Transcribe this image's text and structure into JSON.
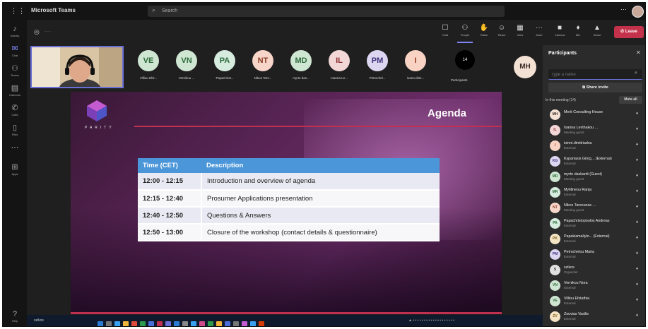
{
  "app": {
    "title": "Microsoft Teams"
  },
  "search": {
    "placeholder": "Search"
  },
  "rail": [
    {
      "label": "Activity",
      "icon": "bell-icon"
    },
    {
      "label": "Chat",
      "icon": "chat-icon"
    },
    {
      "label": "Teams",
      "icon": "teams-icon"
    },
    {
      "label": "Calendar",
      "icon": "calendar-icon"
    },
    {
      "label": "Calls",
      "icon": "phone-icon"
    },
    {
      "label": "Files",
      "icon": "file-icon"
    },
    {
      "label": "",
      "icon": "more-icon"
    },
    {
      "label": "Apps",
      "icon": "apps-icon"
    },
    {
      "label": "Help",
      "icon": "help-icon"
    }
  ],
  "meeting_controls": [
    {
      "label": "Chat",
      "glyph": "☐"
    },
    {
      "label": "People",
      "glyph": "⚇"
    },
    {
      "label": "Raise",
      "glyph": "✋"
    },
    {
      "label": "React",
      "glyph": "☺"
    },
    {
      "label": "View",
      "glyph": "▦"
    },
    {
      "label": "More",
      "glyph": "⋯"
    }
  ],
  "media_controls": [
    {
      "label": "Camera",
      "glyph": "■"
    },
    {
      "label": "Mic",
      "glyph": "♦"
    },
    {
      "label": "Share",
      "glyph": "▲"
    }
  ],
  "leave": {
    "label": "Leave"
  },
  "gallery": [
    {
      "initials": "VE",
      "name": "Villiou Elsl...",
      "bg": "#cfe6d2",
      "fg": "#2c6b3a"
    },
    {
      "initials": "VN",
      "name": "Vernikou ...",
      "bg": "#cfe6d2",
      "fg": "#2c6b3a"
    },
    {
      "initials": "PA",
      "name": "Papachrist...",
      "bg": "#d5ecdf",
      "fg": "#2c6b3a"
    },
    {
      "initials": "NT",
      "name": "Nikos Tars...",
      "bg": "#f7d5c8",
      "fg": "#8a3b23"
    },
    {
      "initials": "MD",
      "name": "myrto das...",
      "bg": "#cfe6d2",
      "fg": "#2c6b3a"
    },
    {
      "initials": "IL",
      "name": "Ioanna Le...",
      "bg": "#f3d6d6",
      "fg": "#8a2c2c"
    },
    {
      "initials": "PM",
      "name": "Petrochel...",
      "bg": "#dcd6f0",
      "fg": "#3d2f7a"
    },
    {
      "initials": "I",
      "name": "ioann.dimi...",
      "bg": "#f8d3c4",
      "fg": "#9a3b20"
    }
  ],
  "gallery_more": {
    "count": "14",
    "label": "Participants"
  },
  "mh_tile": {
    "initials": "MH"
  },
  "slide": {
    "logo": "PARITY",
    "title": "Agenda",
    "table": {
      "headers": [
        "Time (CET)",
        "Description"
      ],
      "rows": [
        [
          "12:00 - 12:15",
          "Introduction and overview of agenda"
        ],
        [
          "12:15 - 12:40",
          "Prosumer Applications presentation"
        ],
        [
          "12:40 - 12:50",
          "Questions & Answers"
        ],
        [
          "12:50 - 13:00",
          "Closure of the workshop (contact details & questionnaire)"
        ]
      ]
    }
  },
  "taskbar": {
    "label": "szikos"
  },
  "panel": {
    "title": "Participants",
    "invite_placeholder": "Type a name",
    "share_invite": "Share invite",
    "in_meeting": "In this meeting (14)",
    "mute_all": "Mute all",
    "participants": [
      {
        "initials": "MH",
        "name": "Merit Consulting House",
        "sub": "",
        "bg": "#f3e1d4",
        "fg": "#3b2b25"
      },
      {
        "initials": "IL",
        "name": "Ioanna Levthakou ...",
        "sub": "Meeting guest",
        "bg": "#f3d6d6",
        "fg": "#8a2c2c"
      },
      {
        "initials": "I",
        "name": "ioinni.dimitriadou",
        "sub": "External",
        "bg": "#f8d3c4",
        "fg": "#9a3b20"
      },
      {
        "initials": "KG",
        "name": "Kypariasis Giorg... (External)",
        "sub": "External",
        "bg": "#dcd6f0",
        "fg": "#3d2f7a"
      },
      {
        "initials": "MD",
        "name": "myrto daskardi (Guest)",
        "sub": "Meeting guest",
        "bg": "#cfe6d2",
        "fg": "#2c6b3a"
      },
      {
        "initials": "MR",
        "name": "Mytilineou Ranja",
        "sub": "External",
        "bg": "#d5ecdf",
        "fg": "#2c6b3a"
      },
      {
        "initials": "NT",
        "name": "Nikos Tarsounas ...",
        "sub": "Meeting guest",
        "bg": "#f7d5c8",
        "fg": "#8a3b23"
      },
      {
        "initials": "PA",
        "name": "Papachristopoulos Andreas",
        "sub": "External",
        "bg": "#d5ecdf",
        "fg": "#2c6b3a"
      },
      {
        "initials": "PK",
        "name": "Papakiamallylo... (External)",
        "sub": "External",
        "bg": "#f4e4c4",
        "fg": "#7a5a1a"
      },
      {
        "initials": "PM",
        "name": "Petrochelou Maria",
        "sub": "External",
        "bg": "#dcd6f0",
        "fg": "#3d2f7a"
      },
      {
        "initials": "S",
        "name": "szikos",
        "sub": "Organizer",
        "bg": "#e0e0e0",
        "fg": "#333"
      },
      {
        "initials": "VN",
        "name": "Vernikou Nora",
        "sub": "External",
        "bg": "#cfe6d2",
        "fg": "#2c6b3a"
      },
      {
        "initials": "VE",
        "name": "Villiou Efstathia",
        "sub": "External",
        "bg": "#cfe6d2",
        "fg": "#2c6b3a"
      },
      {
        "initials": "ZV",
        "name": "Zouvias Vasilis",
        "sub": "External",
        "bg": "#f4e4c4",
        "fg": "#7a5a1a"
      }
    ]
  },
  "colors": {
    "accent": "#6b6fd8",
    "leave": "#c4314b",
    "table_header": "#4a96d9"
  }
}
